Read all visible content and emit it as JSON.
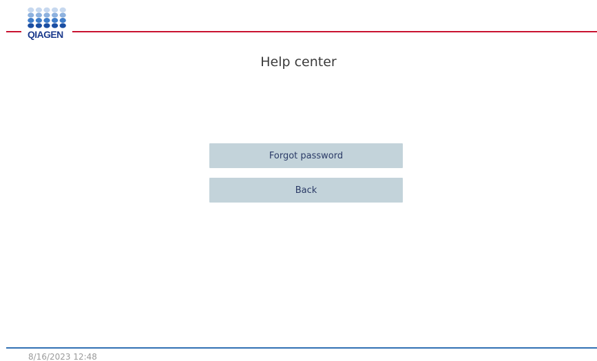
{
  "brand": {
    "name": "QIAGEN",
    "logo_icon": "qiagen-dot-matrix-icon",
    "text_color": "#1b3a8c",
    "accent_color": "#c8102e",
    "dot_colors": [
      "#c6d8ef",
      "#8db1de",
      "#3e7cc9",
      "#1b4fa3"
    ]
  },
  "header": {
    "title": "Help center"
  },
  "actions": {
    "forgot_password_label": "Forgot password",
    "back_label": "Back",
    "button_bg": "#c3d3da",
    "button_text_color": "#2a3a66"
  },
  "footer": {
    "timestamp": "8/16/2023 12:48",
    "line_color": "#2f6fb3"
  }
}
